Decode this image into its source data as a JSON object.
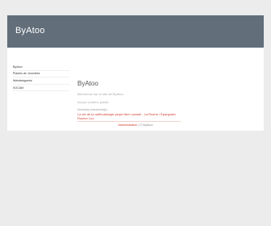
{
  "header": {
    "site_title": "ByAtoo"
  },
  "sidebar": {
    "items": [
      {
        "label": "ByAtoo"
      },
      {
        "label": "Plantes de Jonchées"
      },
      {
        "label": "Webdesignerie"
      },
      {
        "label": "SOCAM"
      }
    ]
  },
  "main": {
    "title": "ByAtoo",
    "welcome": "Bienvenue sur le site de ByAtoo",
    "no_content": "Aucun contenu publié.",
    "latest_label": "Dernier(s) évènement(s)",
    "latest_link": "La vie de la méthodologie projet Item conseil - La Roche / Épargnant Rocher Lco"
  },
  "footer": {
    "link": "Administration",
    "text": "| © ByAtoo"
  },
  "colors": {
    "header_bg": "#626e7a",
    "page_bg": "#ececec",
    "link": "#d23b2c"
  }
}
